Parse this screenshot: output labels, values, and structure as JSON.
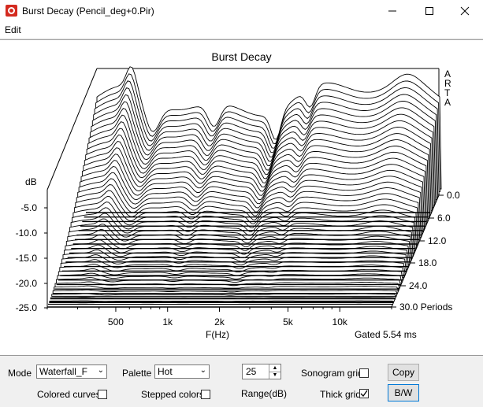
{
  "window": {
    "title": "Burst Decay  (Pencil_deg+0.Pir)",
    "minimize_icon": "minimize-icon",
    "maximize_icon": "maximize-icon",
    "close_icon": "close-icon"
  },
  "menu": {
    "edit": "Edit"
  },
  "chart": {
    "title": "Burst Decay",
    "ylabel": "dB",
    "brand": [
      "A",
      "R",
      "T",
      "A"
    ],
    "y_ticks": [
      "-5.0",
      "-10.0",
      "-15.0",
      "-20.0",
      "-25.0"
    ],
    "x_ticks": [
      "500",
      "1k",
      "2k",
      "5k",
      "10k"
    ],
    "xlabel": "F(Hz)",
    "gated": "Gated 5.54 ms",
    "z_ticks": [
      "0.0",
      "6.0",
      "12.0",
      "18.0",
      "24.0",
      "30.0 Periods"
    ]
  },
  "chart_data": {
    "type": "area",
    "title": "Burst Decay",
    "xlabel": "F(Hz)",
    "ylabel": "dB",
    "x_scale": "log",
    "x_ticks": [
      500,
      1000,
      2000,
      5000,
      10000
    ],
    "y_range": [
      -25,
      0
    ],
    "z_label": "Periods",
    "z_range": [
      0,
      30
    ],
    "style": "waterfall",
    "colors": {
      "lines": "#000000",
      "fill": "#ffffff"
    }
  },
  "controls": {
    "mode_label": "Mode",
    "mode_value": "Waterfall_F",
    "palette_label": "Palette",
    "palette_value": "Hot",
    "range_value": "25",
    "range_label": "Range(dB)",
    "sonogram_grid_label": "Sonogram grid",
    "colored_curves_label": "Colored curves",
    "stepped_colors_label": "Stepped colors",
    "thick_grid_label": "Thick grid",
    "copy_button": "Copy",
    "bw_button": "B/W",
    "sonogram_grid_checked": false,
    "colored_curves_checked": false,
    "stepped_colors_checked": false,
    "thick_grid_checked": true
  }
}
